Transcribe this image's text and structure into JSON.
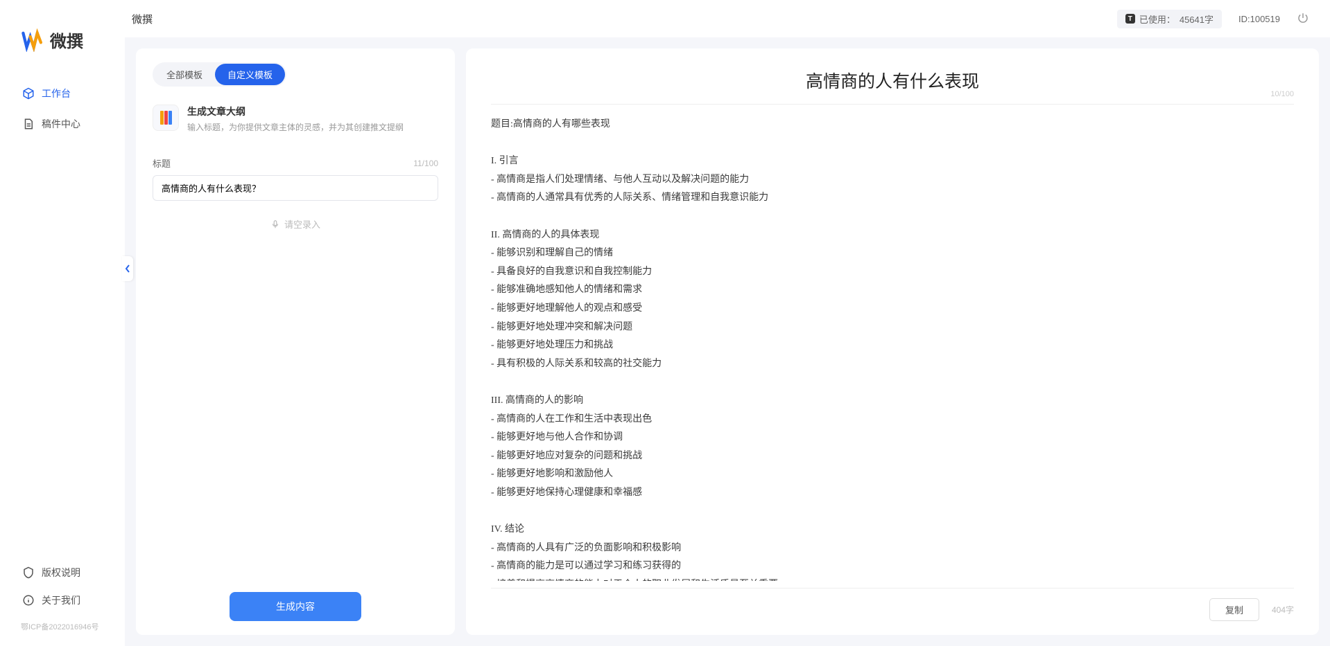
{
  "app_name": "微撰",
  "sidebar": {
    "logo_text": "微撰",
    "nav": [
      {
        "label": "工作台",
        "active": true
      },
      {
        "label": "稿件中心",
        "active": false
      }
    ],
    "footer": [
      {
        "label": "版权说明"
      },
      {
        "label": "关于我们"
      }
    ],
    "icp": "鄂ICP备2022016946号"
  },
  "topbar": {
    "title": "微撰",
    "usage_prefix": "已使用：",
    "usage_value": "45641字",
    "id_label": "ID:100519"
  },
  "left_panel": {
    "tabs": [
      {
        "label": "全部模板",
        "active": false
      },
      {
        "label": "自定义模板",
        "active": true
      }
    ],
    "template": {
      "title": "生成文章大纲",
      "desc": "输入标题，为你提供文章主体的灵感，并为其创建推文提纲"
    },
    "field_label": "标题",
    "title_counter": "11/100",
    "title_value": "高情商的人有什么表现？",
    "voice_hint": "请空录入",
    "generate_label": "生成内容"
  },
  "right_panel": {
    "title": "高情商的人有什么表现",
    "title_counter": "10/100",
    "body": "题目:高情商的人有哪些表现\n\nI. 引言\n- 高情商是指人们处理情绪、与他人互动以及解决问题的能力\n- 高情商的人通常具有优秀的人际关系、情绪管理和自我意识能力\n\nII. 高情商的人的具体表现\n- 能够识别和理解自己的情绪\n- 具备良好的自我意识和自我控制能力\n- 能够准确地感知他人的情绪和需求\n- 能够更好地理解他人的观点和感受\n- 能够更好地处理冲突和解决问题\n- 能够更好地处理压力和挑战\n- 具有积极的人际关系和较高的社交能力\n\nIII. 高情商的人的影响\n- 高情商的人在工作和生活中表现出色\n- 能够更好地与他人合作和协调\n- 能够更好地应对复杂的问题和挑战\n- 能够更好地影响和激励他人\n- 能够更好地保持心理健康和幸福感\n\nIV. 结论\n- 高情商的人具有广泛的负面影响和积极影响\n- 高情商的能力是可以通过学习和练习获得的\n- 培养和提高高情商的能力对于个人的职业发展和生活质量至关重要。",
    "copy_label": "复制",
    "word_count": "404字"
  }
}
